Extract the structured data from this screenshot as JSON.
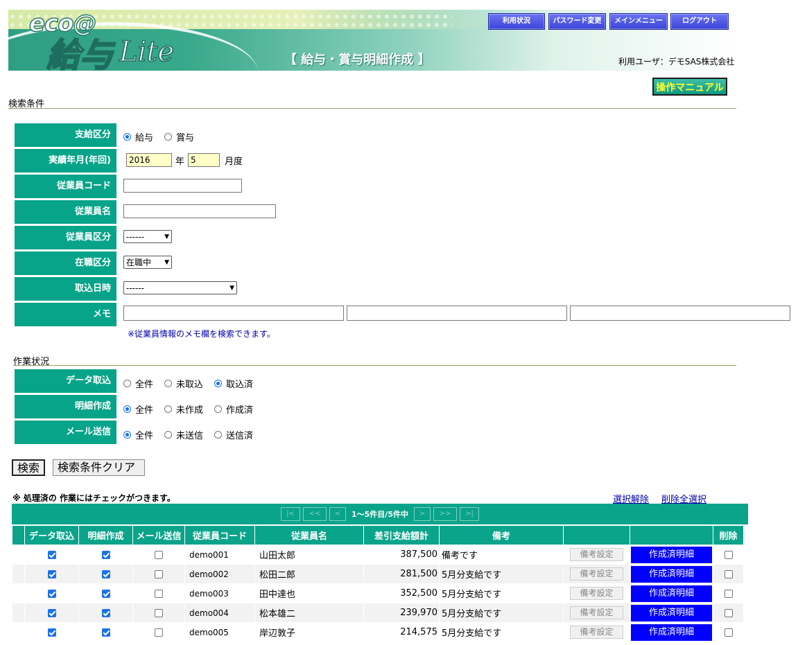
{
  "header": {
    "logo_eco": "eco@",
    "logo_main": "給与",
    "logo_lite": "Lite",
    "page_title": "【 給与・賞与明細作成 】",
    "user_info": "利用ユーザ：デモSAS株式会社",
    "buttons": [
      "利用状況",
      "パスワード変更",
      "メインメニュー",
      "ログアウト"
    ],
    "manual_button": "操作マニュアル"
  },
  "search": {
    "section_label": "検索条件",
    "pay_type": {
      "label": "支給区分",
      "options": [
        "給与",
        "賞与"
      ],
      "selected": "給与"
    },
    "period": {
      "label": "実績年月(年回)",
      "year": "2016",
      "year_unit": "年",
      "month": "5",
      "month_unit": "月度"
    },
    "emp_code": {
      "label": "従業員コード",
      "value": ""
    },
    "emp_name": {
      "label": "従業員名",
      "value": ""
    },
    "emp_class": {
      "label": "従業員区分",
      "selected": "------"
    },
    "status": {
      "label": "在職区分",
      "selected": "在職中"
    },
    "import_date": {
      "label": "取込日時",
      "selected": "------"
    },
    "memo": {
      "label": "メモ",
      "note": "※従業員情報のメモ欄を検索できます。"
    }
  },
  "work": {
    "section_label": "作業状況",
    "data_import": {
      "label": "データ取込",
      "options": [
        "全件",
        "未取込",
        "取込済"
      ],
      "selected": "取込済"
    },
    "detail": {
      "label": "明細作成",
      "options": [
        "全件",
        "未作成",
        "作成済"
      ],
      "selected": "全件"
    },
    "mail": {
      "label": "メール送信",
      "options": [
        "全件",
        "未送信",
        "送信済"
      ],
      "selected": "全件"
    }
  },
  "actions": {
    "search": "検索",
    "clear": "検索条件クリア"
  },
  "results": {
    "note": "※ 処理済の 作業にはチェックがつきます。",
    "deselect": "選択解除",
    "select_all_delete": "削除全選択",
    "pager_text": "1～5件目/5件中",
    "headers": [
      "データ取込",
      "明細作成",
      "メール送信",
      "従業員コード",
      "従業員名",
      "差引支給額計",
      "備考",
      "",
      "",
      "削除"
    ],
    "memo_button": "備考設定",
    "pdf_button": "作成済明細",
    "rows": [
      {
        "imported": true,
        "created": true,
        "mailed": false,
        "code": "demo001",
        "name": "山田太郎",
        "amount": "387,500",
        "remark": "備考です",
        "delete": false
      },
      {
        "imported": true,
        "created": true,
        "mailed": false,
        "code": "demo002",
        "name": "松田二郎",
        "amount": "281,500",
        "remark": "5月分支給です",
        "delete": false
      },
      {
        "imported": true,
        "created": true,
        "mailed": false,
        "code": "demo003",
        "name": "田中達也",
        "amount": "352,500",
        "remark": "5月分支給です",
        "delete": false
      },
      {
        "imported": true,
        "created": true,
        "mailed": false,
        "code": "demo004",
        "name": "松本雄二",
        "amount": "239,970",
        "remark": "5月分支給です",
        "delete": false
      },
      {
        "imported": true,
        "created": true,
        "mailed": false,
        "code": "demo005",
        "name": "岸辺敦子",
        "amount": "214,575",
        "remark": "5月分支給です",
        "delete": false
      }
    ]
  }
}
